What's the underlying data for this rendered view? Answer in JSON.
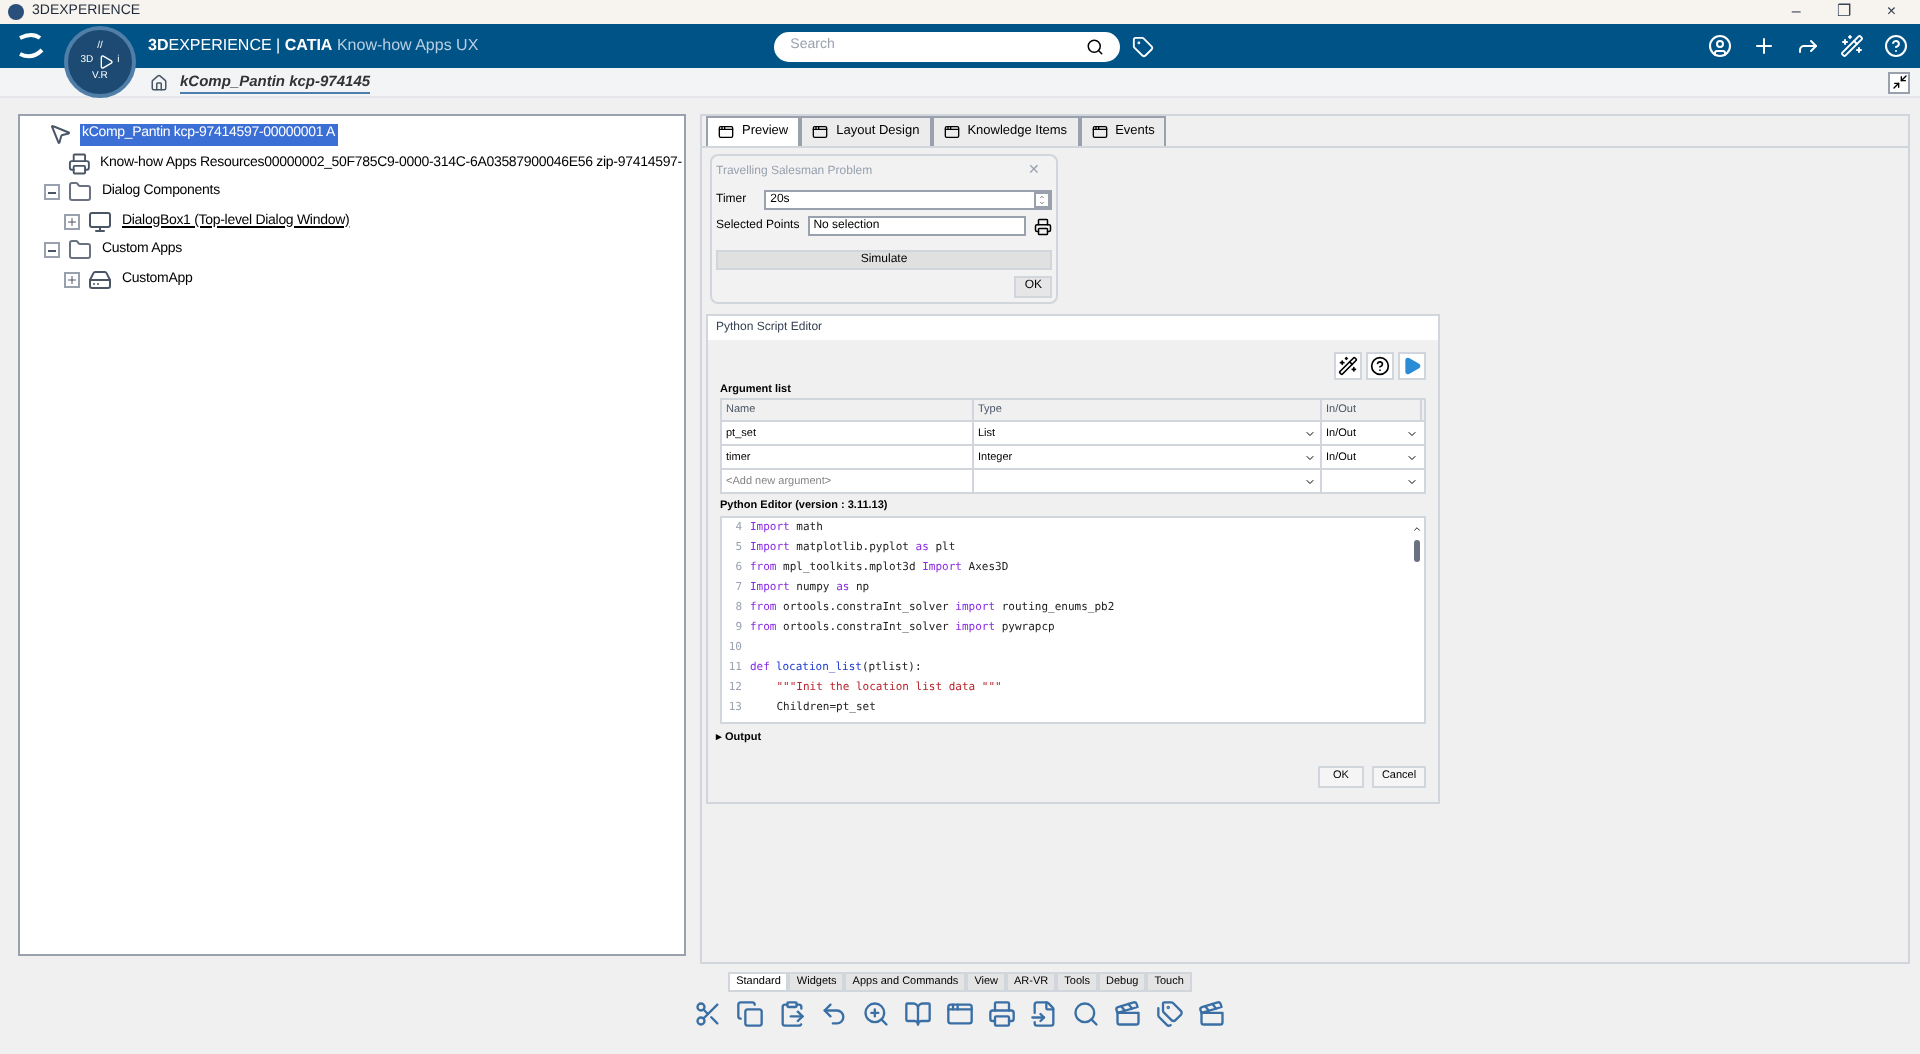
{
  "window": {
    "title": "3DEXPERIENCE",
    "controls": [
      "–",
      "❐",
      "×"
    ]
  },
  "header": {
    "brand_bold": "3D",
    "brand": "EXPERIENCE",
    "separator": "|",
    "product": "CATIA",
    "app": "Know-how Apps UX",
    "compass_top": "//",
    "compass_left": "3D",
    "compass_right": "i",
    "compass_bottom": "V.R",
    "search": {
      "placeholder": "Search"
    }
  },
  "breadcrumb": {
    "title": "kComp_Pantin kcp-974145"
  },
  "tree": [
    {
      "label": "kComp_Pantin kcp-97414597-00000001 A",
      "kind": "root",
      "selected": true,
      "children": [
        {
          "label": "Know-how Apps Resources00000002_50F785C9-0000-314C-6A03587900046E56 zip-97414597-",
          "kind": "resource",
          "selected": false
        },
        {
          "label": "Dialog Components",
          "kind": "folder",
          "selected": false,
          "expanded": true,
          "children": [
            {
              "label": "DialogBox1 (Top-level Dialog Window)",
              "kind": "dialog",
              "selected": false,
              "expanded": false
            }
          ]
        },
        {
          "label": "Custom Apps",
          "kind": "folder",
          "selected": false,
          "expanded": true,
          "children": [
            {
              "label": "CustomApp",
              "kind": "app",
              "selected": false,
              "expanded": false
            }
          ]
        }
      ]
    }
  ],
  "tabs": [
    {
      "label": "Preview",
      "selected": true
    },
    {
      "label": "Layout Design",
      "selected": false
    },
    {
      "label": "Knowledge Items",
      "selected": false
    },
    {
      "label": "Events",
      "selected": false
    }
  ],
  "preview_dialog": {
    "title": "Travelling Salesman Problem",
    "close": "✕",
    "timer_label": "Timer",
    "timer_value": "20s",
    "points_label": "Selected Points",
    "points_value": "No selection",
    "simulate": "Simulate",
    "ok": "OK"
  },
  "script_editor": {
    "title": "Python Script Editor",
    "argument_list": "Argument list",
    "columns": [
      "Name",
      "Type",
      "In/Out"
    ],
    "arguments": [
      {
        "name": "pt_set",
        "type": "List",
        "inout": "In/Out"
      },
      {
        "name": "timer",
        "type": "Integer",
        "inout": "In/Out"
      }
    ],
    "new_argument": {
      "placeholder": "<Add new argument>"
    },
    "editor_title": "Python Editor (version : 3.11.13)",
    "code": [
      {
        "num": "4",
        "segments": [
          {
            "kind": "kw",
            "text": "Import"
          },
          {
            "kind": "plain",
            "text": " math"
          }
        ]
      },
      {
        "num": "5",
        "segments": [
          {
            "kind": "kw",
            "text": "Import"
          },
          {
            "kind": "plain",
            "text": " matplotlib.pyplot "
          },
          {
            "kind": "kw",
            "text": "as"
          },
          {
            "kind": "plain",
            "text": " plt"
          }
        ]
      },
      {
        "num": "6",
        "segments": [
          {
            "kind": "kw",
            "text": "from"
          },
          {
            "kind": "plain",
            "text": " mpl_toolkits.mplot3d "
          },
          {
            "kind": "kw",
            "text": "Import"
          },
          {
            "kind": "plain",
            "text": " Axes3D"
          }
        ]
      },
      {
        "num": "7",
        "segments": [
          {
            "kind": "kw",
            "text": "Import"
          },
          {
            "kind": "plain",
            "text": " numpy "
          },
          {
            "kind": "kw",
            "text": "as"
          },
          {
            "kind": "plain",
            "text": " np"
          }
        ]
      },
      {
        "num": "8",
        "segments": [
          {
            "kind": "kw",
            "text": "from"
          },
          {
            "kind": "plain",
            "text": " ortools.constraInt_solver "
          },
          {
            "kind": "kw",
            "text": "import"
          },
          {
            "kind": "plain",
            "text": " routing_enums_pb2"
          }
        ]
      },
      {
        "num": "9",
        "segments": [
          {
            "kind": "kw",
            "text": "from"
          },
          {
            "kind": "plain",
            "text": " ortools.constraInt_solver "
          },
          {
            "kind": "kw",
            "text": "import"
          },
          {
            "kind": "plain",
            "text": " pywrapcp"
          }
        ]
      },
      {
        "num": "10"
      },
      {
        "num": "11",
        "segments": [
          {
            "kind": "kw",
            "text": "def"
          },
          {
            "kind": "fn",
            "text": "location_list"
          },
          {
            "kind": "plain",
            "text": "(ptlist):"
          }
        ]
      },
      {
        "num": "12",
        "segments": [
          {
            "kind": "str",
            "text": "    \"\"\"Init the location list data \"\"\""
          }
        ]
      },
      {
        "num": "13",
        "segments": [
          {
            "kind": "plain",
            "text": "    Children=pt_set"
          }
        ]
      }
    ],
    "output_arrow": "▸",
    "output": "Output",
    "ok": "OK",
    "cancel": "Cancel"
  },
  "bottom_tabs": [
    {
      "label": "Standard",
      "selected": true
    },
    {
      "label": "Widgets",
      "selected": false
    },
    {
      "label": "Apps and Commands",
      "selected": false
    },
    {
      "label": "View",
      "selected": false
    },
    {
      "label": "AR-VR",
      "selected": false
    },
    {
      "label": "Tools",
      "selected": false
    },
    {
      "label": "Debug",
      "selected": false
    },
    {
      "label": "Touch",
      "selected": false
    }
  ]
}
